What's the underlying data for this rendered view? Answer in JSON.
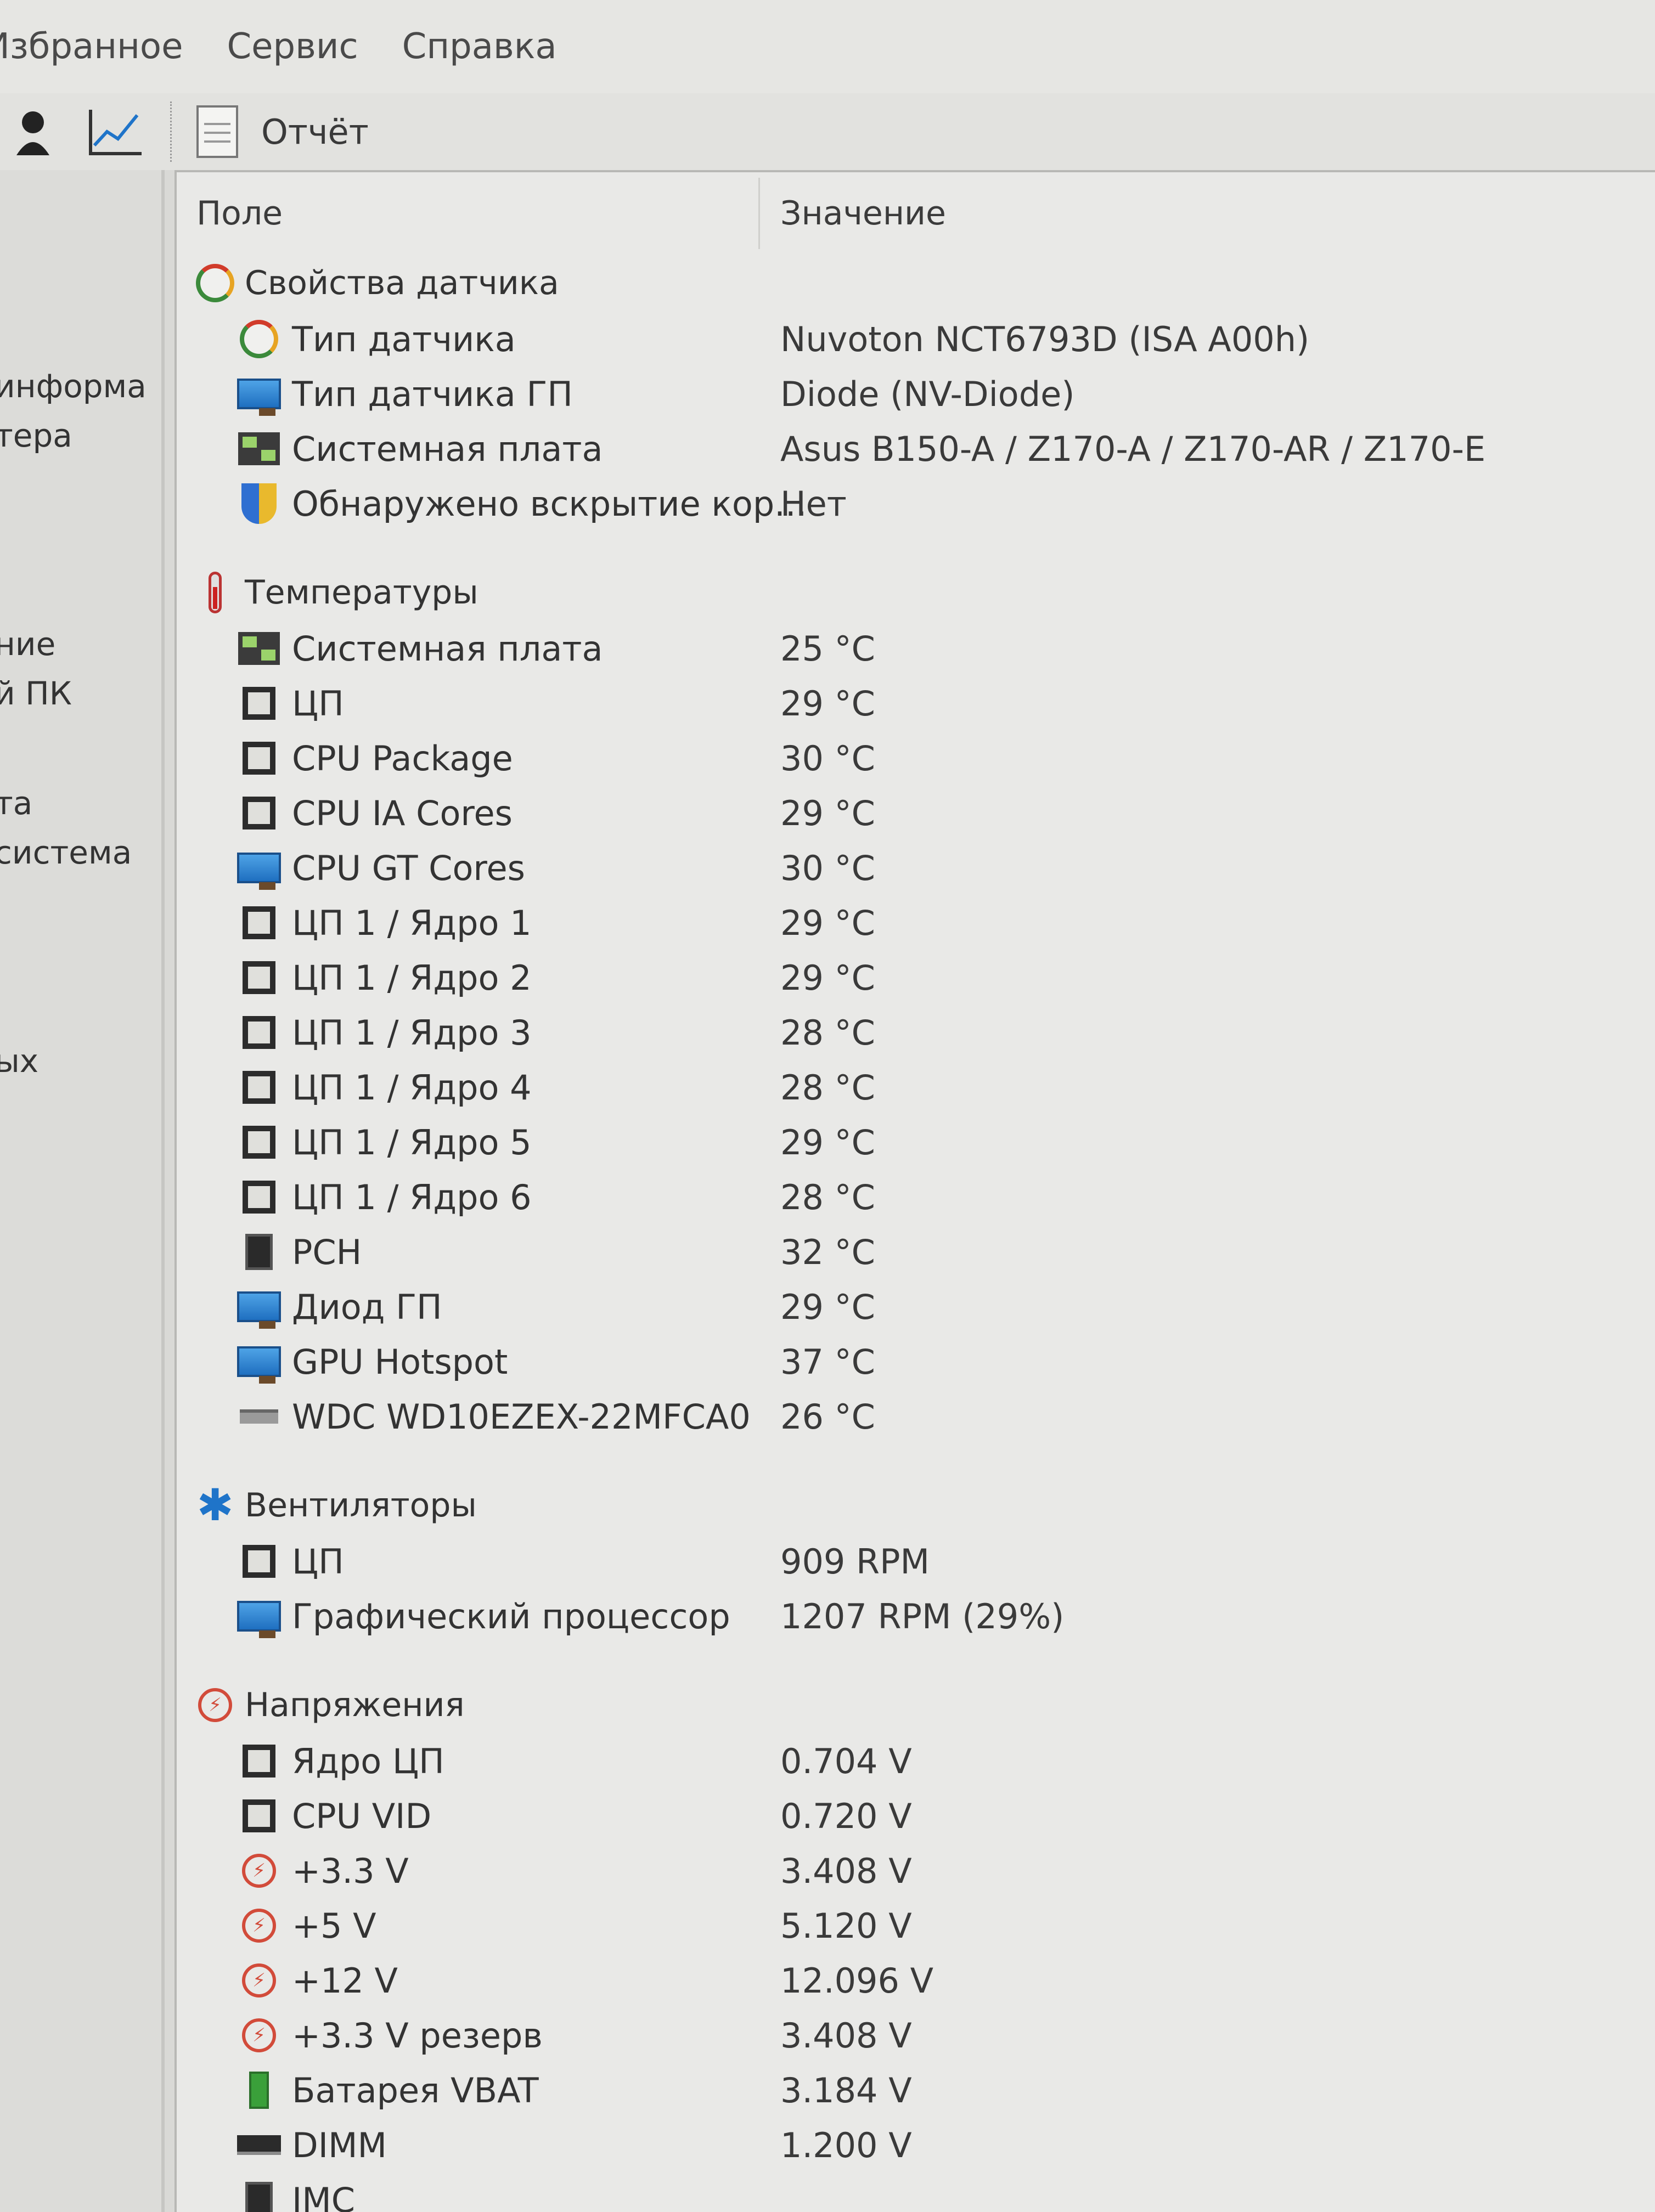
{
  "menu": [
    "Избранное",
    "Сервис",
    "Справка"
  ],
  "toolbar": {
    "report_label": "Отчёт"
  },
  "left_panel": [
    "информа",
    "тера",
    "ние",
    "й ПК",
    "та",
    "система",
    "ых"
  ],
  "columns": {
    "field": "Поле",
    "value": "Значение"
  },
  "sections": [
    {
      "title": "Свойства датчика",
      "icon": "gauge-icon",
      "rows": [
        {
          "icon": "gauge-icon",
          "field": "Тип датчика",
          "value": "Nuvoton NCT6793D  (ISA A00h)"
        },
        {
          "icon": "gpu-icon",
          "field": "Тип датчика ГП",
          "value": "Diode  (NV-Diode)"
        },
        {
          "icon": "motherboard-icon",
          "field": "Системная плата",
          "value": "Asus B150-A / Z170-A / Z170-AR / Z170-E"
        },
        {
          "icon": "shield-icon",
          "field": "Обнаружено вскрытие кор...",
          "value": "Нет"
        }
      ]
    },
    {
      "title": "Температуры",
      "icon": "thermometer-icon",
      "rows": [
        {
          "icon": "motherboard-icon",
          "field": "Системная плата",
          "value": "25 °C"
        },
        {
          "icon": "cpu-chip-icon",
          "field": "ЦП",
          "value": "29 °C"
        },
        {
          "icon": "cpu-chip-icon",
          "field": "CPU Package",
          "value": "30 °C"
        },
        {
          "icon": "cpu-chip-icon",
          "field": "CPU IA Cores",
          "value": "29 °C"
        },
        {
          "icon": "gpu-icon",
          "field": "CPU GT Cores",
          "value": "30 °C"
        },
        {
          "icon": "cpu-chip-icon",
          "field": "ЦП 1 / Ядро 1",
          "value": "29 °C"
        },
        {
          "icon": "cpu-chip-icon",
          "field": "ЦП 1 / Ядро 2",
          "value": "29 °C"
        },
        {
          "icon": "cpu-chip-icon",
          "field": "ЦП 1 / Ядро 3",
          "value": "28 °C"
        },
        {
          "icon": "cpu-chip-icon",
          "field": "ЦП 1 / Ядро 4",
          "value": "28 °C"
        },
        {
          "icon": "cpu-chip-icon",
          "field": "ЦП 1 / Ядро 5",
          "value": "29 °C"
        },
        {
          "icon": "cpu-chip-icon",
          "field": "ЦП 1 / Ядро 6",
          "value": "28 °C"
        },
        {
          "icon": "pch-chip-icon",
          "field": "PCH",
          "value": "32 °C"
        },
        {
          "icon": "gpu-icon",
          "field": "Диод ГП",
          "value": "29 °C"
        },
        {
          "icon": "gpu-icon",
          "field": "GPU Hotspot",
          "value": "37 °C"
        },
        {
          "icon": "hdd-icon",
          "field": "WDC WD10EZEX-22MFCA0",
          "value": "26 °C"
        }
      ]
    },
    {
      "title": "Вентиляторы",
      "icon": "fan-icon",
      "rows": [
        {
          "icon": "cpu-chip-icon",
          "field": "ЦП",
          "value": "909 RPM"
        },
        {
          "icon": "gpu-icon",
          "field": "Графический процессор",
          "value": "1207 RPM  (29%)"
        }
      ]
    },
    {
      "title": "Напряжения",
      "icon": "voltage-icon",
      "rows": [
        {
          "icon": "cpu-chip-icon",
          "field": "Ядро ЦП",
          "value": "0.704 V"
        },
        {
          "icon": "cpu-chip-icon",
          "field": "CPU VID",
          "value": "0.720 V"
        },
        {
          "icon": "voltage-icon",
          "field": "+3.3 V",
          "value": "3.408 V"
        },
        {
          "icon": "voltage-icon",
          "field": "+5 V",
          "value": "5.120 V"
        },
        {
          "icon": "voltage-icon",
          "field": "+12 V",
          "value": "12.096 V"
        },
        {
          "icon": "voltage-icon",
          "field": "+3.3 V резерв",
          "value": "3.408 V"
        },
        {
          "icon": "battery-icon",
          "field": "Батарея VBAT",
          "value": "3.184 V"
        },
        {
          "icon": "dimm-icon",
          "field": "DIMM",
          "value": "1.200 V"
        },
        {
          "icon": "imc-icon",
          "field": "IMC",
          "value": ""
        }
      ]
    }
  ]
}
